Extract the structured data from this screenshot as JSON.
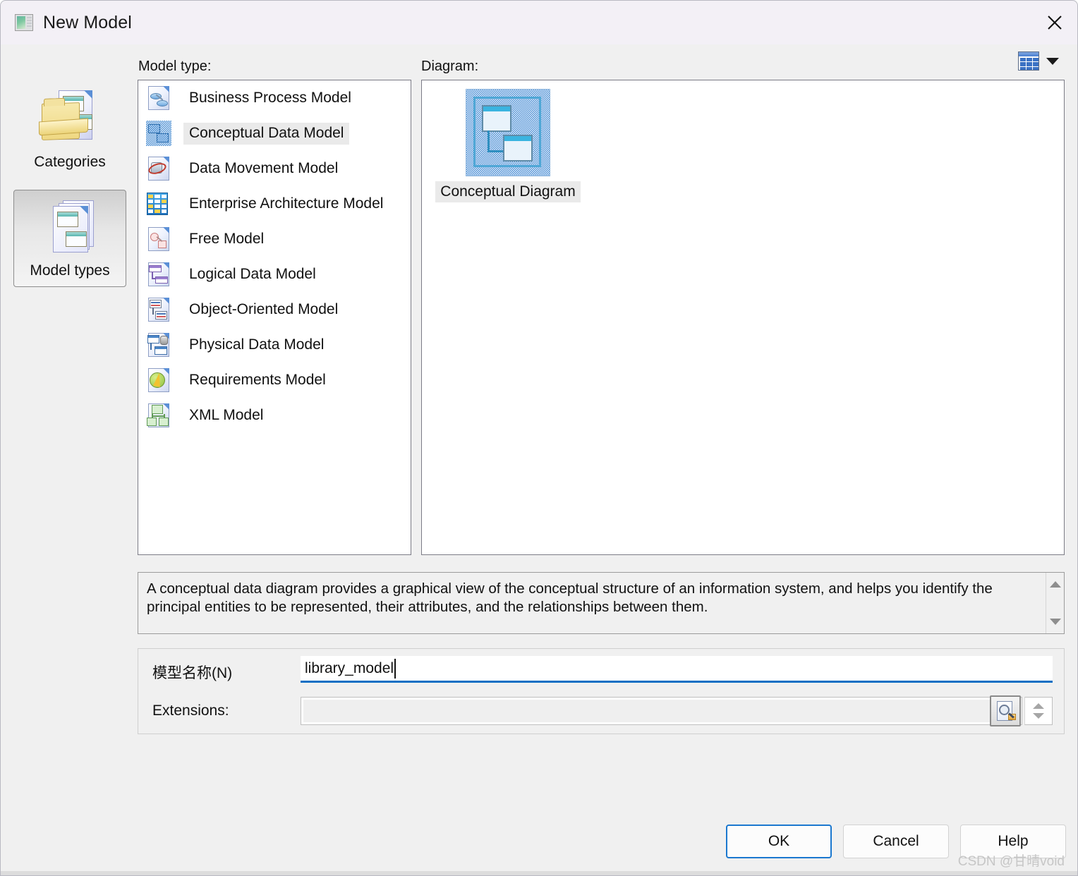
{
  "window": {
    "title": "New Model",
    "title_icon": "model-window-icon",
    "close_icon": "close-icon"
  },
  "labels": {
    "model_type": "Model type:",
    "diagram": "Diagram:"
  },
  "view_switch": {
    "icon": "grid-view-icon",
    "caret": "chevron-down-icon"
  },
  "rail": {
    "items": [
      {
        "label": "Categories",
        "icon": "categories-icon",
        "selected": false
      },
      {
        "label": "Model types",
        "icon": "model-types-icon",
        "selected": true
      }
    ]
  },
  "model_types": {
    "selected": "Conceptual Data Model",
    "items": [
      {
        "label": "Business Process Model",
        "icon": "business-process-model-icon"
      },
      {
        "label": "Conceptual Data Model",
        "icon": "conceptual-data-model-icon"
      },
      {
        "label": "Data Movement Model",
        "icon": "data-movement-model-icon"
      },
      {
        "label": "Enterprise Architecture Model",
        "icon": "enterprise-architecture-model-icon"
      },
      {
        "label": "Free Model",
        "icon": "free-model-icon"
      },
      {
        "label": "Logical Data Model",
        "icon": "logical-data-model-icon"
      },
      {
        "label": "Object-Oriented Model",
        "icon": "object-oriented-model-icon"
      },
      {
        "label": "Physical Data Model",
        "icon": "physical-data-model-icon"
      },
      {
        "label": "Requirements Model",
        "icon": "requirements-model-icon"
      },
      {
        "label": "XML Model",
        "icon": "xml-model-icon"
      }
    ]
  },
  "diagrams": {
    "selected": "Conceptual Diagram",
    "items": [
      {
        "label": "Conceptual Diagram",
        "icon": "conceptual-diagram-thumbnail"
      }
    ]
  },
  "description": {
    "text": "A conceptual data diagram provides a graphical view of the conceptual structure of an information system, and helps you identify the principal entities to be represented, their attributes, and the relationships between them.",
    "scroll_up_icon": "scroll-up-arrow-icon",
    "scroll_down_icon": "scroll-down-arrow-icon"
  },
  "form": {
    "model_name_label": "模型名称(N)",
    "model_name_value": "library_model",
    "extensions_label": "Extensions:",
    "extensions_value": "",
    "browse_icon": "browse-extensions-icon",
    "spinner_up_icon": "spinner-up-icon",
    "spinner_down_icon": "spinner-down-icon"
  },
  "footer": {
    "ok": "OK",
    "cancel": "Cancel",
    "help": "Help"
  },
  "watermark": "CSDN @甘晴void",
  "colors": {
    "accent": "#0c6fc4",
    "titlebar": "#f3f0f6",
    "dialog": "#f0f0f0",
    "selection": "#eaeaea",
    "panel_border": "#7b7b86"
  }
}
